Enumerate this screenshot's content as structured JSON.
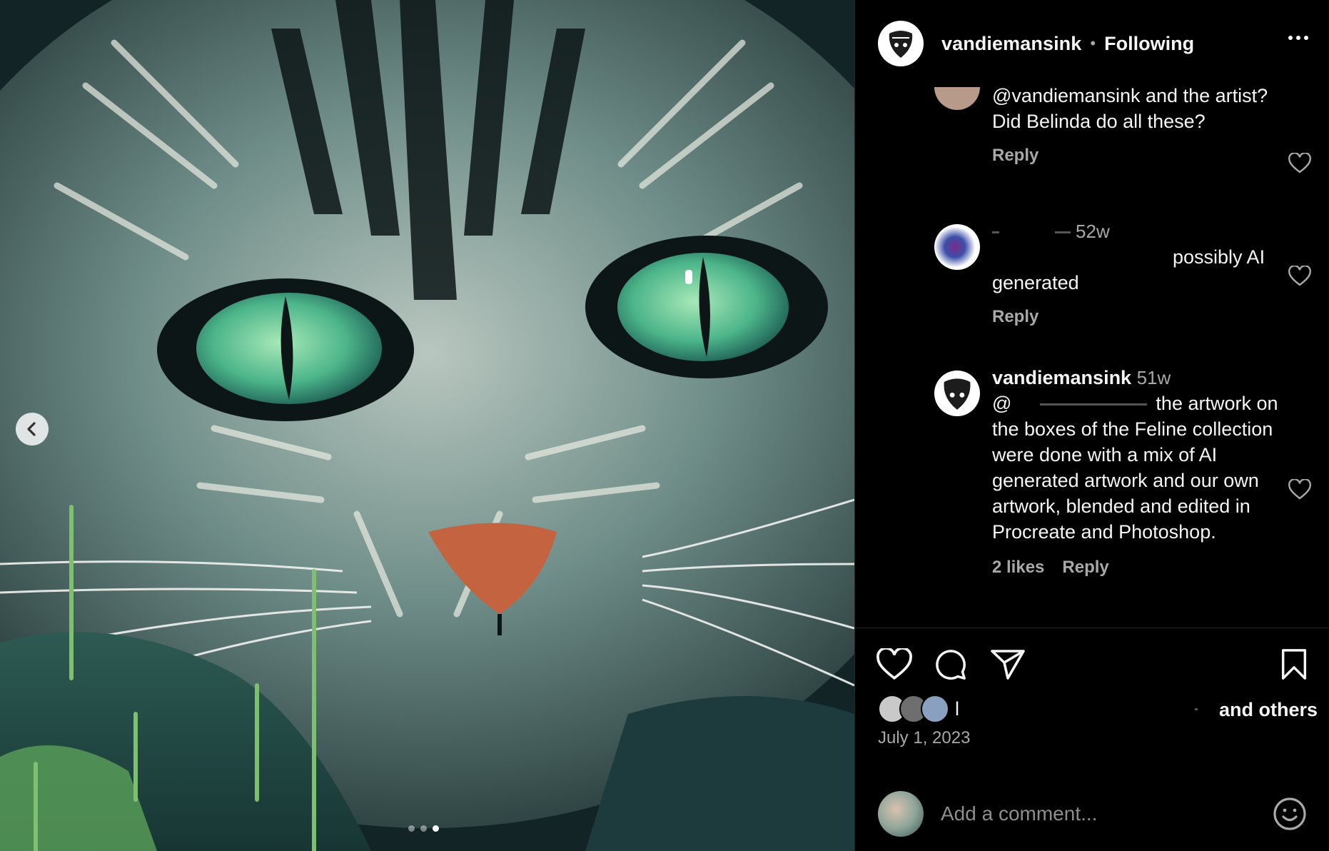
{
  "post": {
    "author": "vandiemansink",
    "separator": "•",
    "follow_status": "Following",
    "carousel": {
      "count": 3,
      "active_index": 2
    },
    "liked_by_suffix": "and others",
    "liked_by_prefix": "l",
    "date": "July 1, 2023"
  },
  "comments": [
    {
      "text": "@vandiemansink and the artist? Did Belinda do all these?",
      "reply_label": "Reply"
    },
    {
      "time": "52w",
      "text_visible": "possibly AI generated",
      "reply_label": "Reply"
    },
    {
      "username": "vandiemansink",
      "time": "51w",
      "mention_prefix": "@",
      "text_after_mention": "the artwork on the boxes of the Feline collection were done with a mix of AI generated artwork and our own artwork, blended and edited in Procreate and Photoshop.",
      "likes_label": "2 likes",
      "reply_label": "Reply"
    }
  ],
  "comment_input": {
    "placeholder": "Add a comment..."
  },
  "icons": {
    "prev": "chevron-left-icon",
    "like": "heart-icon",
    "comment": "comment-bubble-icon",
    "share": "paper-plane-icon",
    "save": "bookmark-icon",
    "more": "more-horizontal-icon",
    "emoji": "smiley-icon"
  },
  "colors": {
    "background": "#000000",
    "text": "#f5f5f5",
    "muted": "#a8a8a8",
    "eye": "#5fc28f",
    "nose": "#c4633f"
  }
}
